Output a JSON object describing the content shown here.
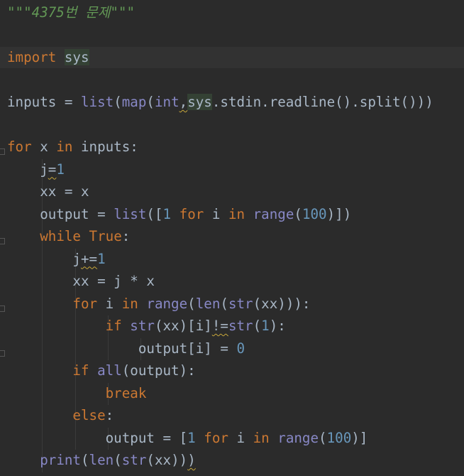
{
  "editor": {
    "lines": [
      [
        [
          "str",
          "\"\"\"4375번 문제\"\"\""
        ]
      ],
      [],
      [
        [
          "kw",
          "import"
        ],
        [
          "t",
          " "
        ],
        [
          "sel",
          "sys"
        ]
      ],
      [],
      [
        [
          "t",
          "inputs = "
        ],
        [
          "bi",
          "list"
        ],
        [
          "t",
          "("
        ],
        [
          "bi",
          "map"
        ],
        [
          "t",
          "("
        ],
        [
          "bi",
          "int"
        ],
        [
          "sq",
          ","
        ],
        [
          "sel",
          "sys"
        ],
        [
          "t",
          ".stdin.readline().split()))"
        ]
      ],
      [],
      [
        [
          "kw",
          "for"
        ],
        [
          "t",
          " x "
        ],
        [
          "kw",
          "in"
        ],
        [
          "t",
          " inputs:"
        ]
      ],
      [
        [
          "t",
          "    j"
        ],
        [
          "sq",
          "="
        ],
        [
          "num",
          "1"
        ]
      ],
      [
        [
          "t",
          "    xx = x"
        ]
      ],
      [
        [
          "t",
          "    output = "
        ],
        [
          "bi",
          "list"
        ],
        [
          "t",
          "(["
        ],
        [
          "num",
          "1"
        ],
        [
          "t",
          " "
        ],
        [
          "kw",
          "for"
        ],
        [
          "t",
          " i "
        ],
        [
          "kw",
          "in"
        ],
        [
          "t",
          " "
        ],
        [
          "bi",
          "range"
        ],
        [
          "t",
          "("
        ],
        [
          "num",
          "100"
        ],
        [
          "t",
          ")])"
        ]
      ],
      [
        [
          "t",
          "    "
        ],
        [
          "kw",
          "while"
        ],
        [
          "t",
          " "
        ],
        [
          "kw",
          "True"
        ],
        [
          "t",
          ":"
        ]
      ],
      [
        [
          "t",
          "        j"
        ],
        [
          "sq",
          "+="
        ],
        [
          "num",
          "1"
        ]
      ],
      [
        [
          "t",
          "        xx = j * x"
        ]
      ],
      [
        [
          "t",
          "        "
        ],
        [
          "kw",
          "for"
        ],
        [
          "t",
          " i "
        ],
        [
          "kw",
          "in"
        ],
        [
          "t",
          " "
        ],
        [
          "bi",
          "range"
        ],
        [
          "t",
          "("
        ],
        [
          "bi",
          "len"
        ],
        [
          "t",
          "("
        ],
        [
          "bi",
          "str"
        ],
        [
          "t",
          "(xx))):"
        ]
      ],
      [
        [
          "t",
          "            "
        ],
        [
          "kw",
          "if"
        ],
        [
          "t",
          " "
        ],
        [
          "bi",
          "str"
        ],
        [
          "t",
          "(xx)[i]"
        ],
        [
          "sq",
          "!="
        ],
        [
          "bi",
          "str"
        ],
        [
          "t",
          "("
        ],
        [
          "num",
          "1"
        ],
        [
          "t",
          "):"
        ]
      ],
      [
        [
          "t",
          "                output[i] = "
        ],
        [
          "num",
          "0"
        ]
      ],
      [
        [
          "t",
          "        "
        ],
        [
          "kw",
          "if"
        ],
        [
          "t",
          " "
        ],
        [
          "bi",
          "all"
        ],
        [
          "t",
          "(output):"
        ]
      ],
      [
        [
          "t",
          "            "
        ],
        [
          "kw",
          "break"
        ]
      ],
      [
        [
          "t",
          "        "
        ],
        [
          "kw",
          "else"
        ],
        [
          "t",
          ":"
        ]
      ],
      [
        [
          "t",
          "            output = ["
        ],
        [
          "num",
          "1"
        ],
        [
          "t",
          " "
        ],
        [
          "kw",
          "for"
        ],
        [
          "t",
          " i "
        ],
        [
          "kw",
          "in"
        ],
        [
          "t",
          " "
        ],
        [
          "bi",
          "range"
        ],
        [
          "t",
          "("
        ],
        [
          "num",
          "100"
        ],
        [
          "t",
          ")]"
        ]
      ],
      [
        [
          "t",
          "    "
        ],
        [
          "bi",
          "print"
        ],
        [
          "t",
          "("
        ],
        [
          "bi",
          "len"
        ],
        [
          "t",
          "("
        ],
        [
          "bi",
          "str"
        ],
        [
          "t",
          "(xx))"
        ],
        [
          "sq",
          ")"
        ]
      ]
    ],
    "current_line": 3,
    "fold_markers": [
      7,
      11,
      14,
      16
    ],
    "colors": {
      "background": "#2b2b2b",
      "text": "#a9b7c6",
      "keyword": "#cc7832",
      "builtin": "#8888c6",
      "number": "#6897bb",
      "docstring": "#629755",
      "identifier_highlight": "#344134",
      "warning_squiggle": "#c9a83a"
    }
  }
}
